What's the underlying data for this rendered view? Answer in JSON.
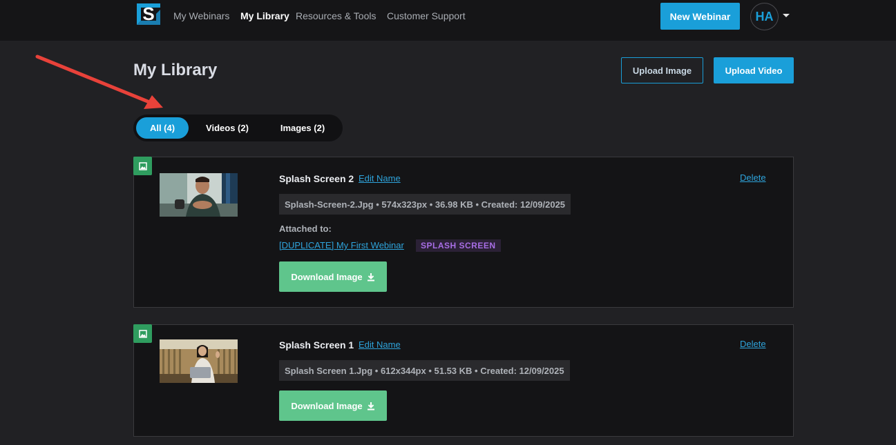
{
  "nav": {
    "links": [
      "My Webinars",
      "My Library",
      "Resources & Tools",
      "Customer Support"
    ],
    "active": "My Library",
    "new_webinar_label": "New Webinar",
    "avatar_initials": "HA"
  },
  "page": {
    "title": "My Library",
    "upload_image_label": "Upload Image",
    "upload_video_label": "Upload Video"
  },
  "tabs": [
    {
      "label": "All (4)",
      "active": true
    },
    {
      "label": "Videos (2)",
      "active": false
    },
    {
      "label": "Images (2)",
      "active": false
    }
  ],
  "items": [
    {
      "name": "Splash Screen 2",
      "edit_label": "Edit Name",
      "delete_label": "Delete",
      "meta": "Splash-Screen-2.Jpg • 574x323px • 36.98 KB •  Created: 12/09/2025",
      "attached_label": "Attached to:",
      "attached_webinar": "[DUPLICATE] My First Webinar",
      "attached_tag": "SPLASH SCREEN",
      "download_label": "Download Image"
    },
    {
      "name": "Splash Screen 1",
      "edit_label": "Edit Name",
      "delete_label": "Delete",
      "meta": "Splash Screen 1.Jpg • 612x344px • 51.53 KB •  Created: 12/09/2025",
      "download_label": "Download Image"
    }
  ],
  "colors": {
    "accent": "#1a9fd9",
    "download": "#5fc58c",
    "image_badge": "#2f9d5f",
    "tag_text": "#a86ee6",
    "annotation_arrow": "#e8423a"
  },
  "icons": [
    "logo-s-icon",
    "chevron-down-icon",
    "image-icon",
    "download-icon",
    "annotation-arrow"
  ]
}
